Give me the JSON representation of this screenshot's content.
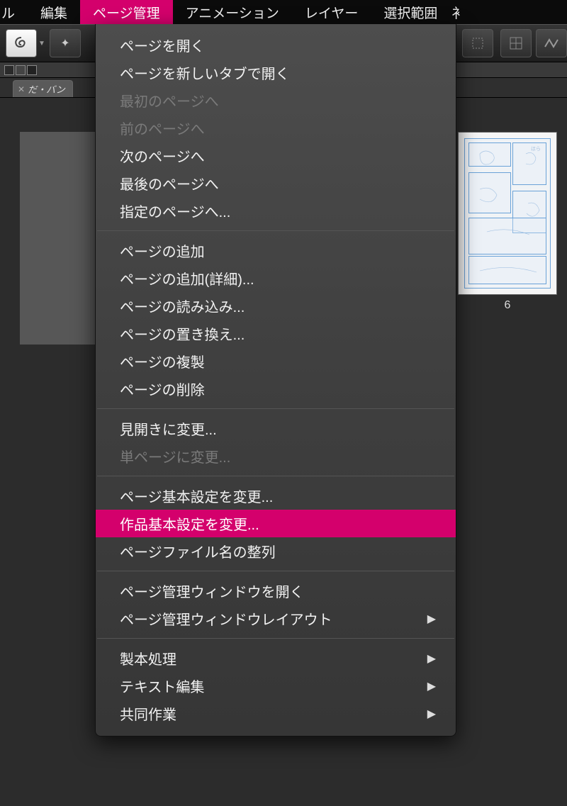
{
  "menubar": {
    "items": [
      {
        "label": "ル"
      },
      {
        "label": "編集"
      },
      {
        "label": "ページ管理",
        "active": true
      },
      {
        "label": "アニメーション"
      },
      {
        "label": "レイヤー"
      },
      {
        "label": "選択範囲"
      },
      {
        "label": "衤"
      }
    ]
  },
  "tab": {
    "label": "だ・バン",
    "close": "✕"
  },
  "thumb": {
    "page_label": "6",
    "speech": "ほら"
  },
  "dropdown": {
    "sections": [
      [
        {
          "label": "ページを開く"
        },
        {
          "label": "ページを新しいタブで開く"
        },
        {
          "label": "最初のページへ",
          "disabled": true
        },
        {
          "label": "前のページへ",
          "disabled": true
        },
        {
          "label": "次のページへ"
        },
        {
          "label": "最後のページへ"
        },
        {
          "label": "指定のページへ..."
        }
      ],
      [
        {
          "label": "ページの追加"
        },
        {
          "label": "ページの追加(詳細)..."
        },
        {
          "label": "ページの読み込み..."
        },
        {
          "label": "ページの置き換え..."
        },
        {
          "label": "ページの複製"
        },
        {
          "label": "ページの削除"
        }
      ],
      [
        {
          "label": "見開きに変更..."
        },
        {
          "label": "単ページに変更...",
          "disabled": true
        }
      ],
      [
        {
          "label": "ページ基本設定を変更..."
        },
        {
          "label": "作品基本設定を変更...",
          "highlight": true
        },
        {
          "label": "ページファイル名の整列"
        }
      ],
      [
        {
          "label": "ページ管理ウィンドウを開く"
        },
        {
          "label": "ページ管理ウィンドウレイアウト",
          "submenu": true
        }
      ],
      [
        {
          "label": "製本処理",
          "submenu": true
        },
        {
          "label": "テキスト編集",
          "submenu": true
        },
        {
          "label": "共同作業",
          "submenu": true
        }
      ]
    ]
  }
}
